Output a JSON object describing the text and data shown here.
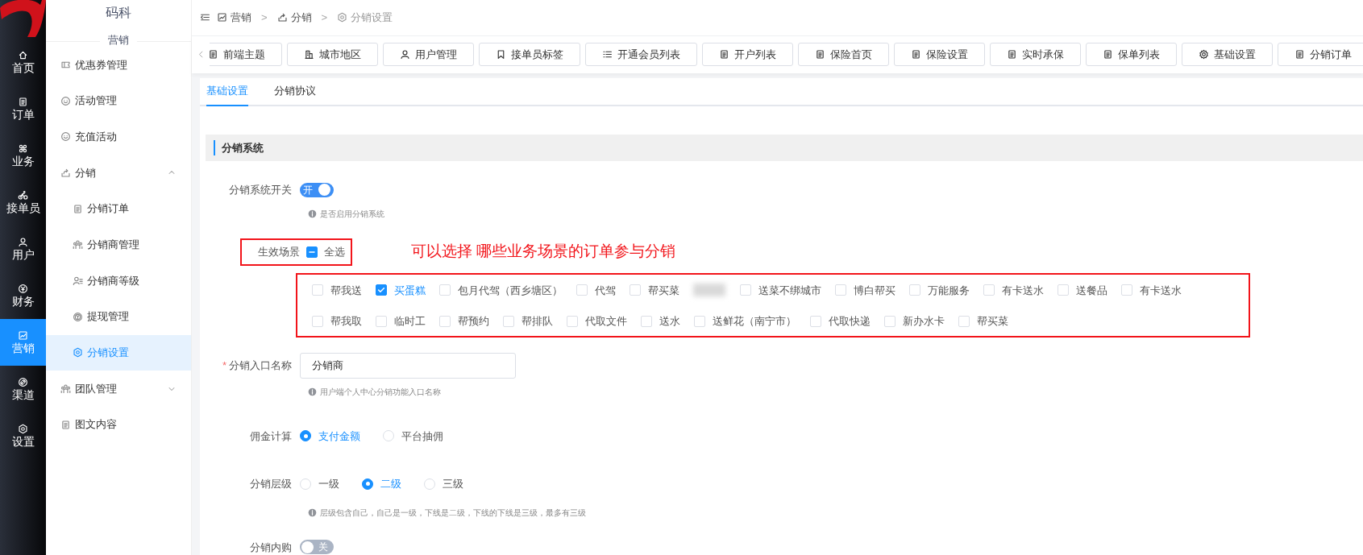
{
  "app_title": "码科",
  "section_title": "营销",
  "rail": [
    {
      "label": "首页",
      "selected": false
    },
    {
      "label": "订单",
      "selected": false
    },
    {
      "label": "业务",
      "selected": false
    },
    {
      "label": "接单员",
      "selected": false
    },
    {
      "label": "用户",
      "selected": false
    },
    {
      "label": "财务",
      "selected": false
    },
    {
      "label": "营销",
      "selected": true
    },
    {
      "label": "渠道",
      "selected": false
    },
    {
      "label": "设置",
      "selected": false
    }
  ],
  "sidebar": [
    {
      "label": "优惠券管理",
      "selected": false
    },
    {
      "label": "活动管理",
      "selected": false
    },
    {
      "label": "充值活动",
      "selected": false
    },
    {
      "label": "分销",
      "selected": false,
      "expanded": true,
      "children": [
        {
          "label": "分销订单",
          "selected": false
        },
        {
          "label": "分销商管理",
          "selected": false
        },
        {
          "label": "分销商等级",
          "selected": false
        },
        {
          "label": "提现管理",
          "selected": false
        },
        {
          "label": "分销设置",
          "selected": true
        }
      ]
    },
    {
      "label": "团队管理",
      "selected": false,
      "expanded": false
    },
    {
      "label": "图文内容",
      "selected": false
    }
  ],
  "breadcrumb": [
    "营销",
    "分销",
    "分销设置"
  ],
  "breadcrumb_separator": ">",
  "page_tabs": [
    {
      "label": "前端主题",
      "selected": false
    },
    {
      "label": "城市地区",
      "selected": false
    },
    {
      "label": "用户管理",
      "selected": false
    },
    {
      "label": "接单员标签",
      "selected": false
    },
    {
      "label": "开通会员列表",
      "selected": false
    },
    {
      "label": "开户列表",
      "selected": false
    },
    {
      "label": "保险首页",
      "selected": false
    },
    {
      "label": "保险设置",
      "selected": false
    },
    {
      "label": "实时承保",
      "selected": false
    },
    {
      "label": "保单列表",
      "selected": false
    },
    {
      "label": "基础设置",
      "selected": false
    },
    {
      "label": "分销订单",
      "selected": false
    }
  ],
  "content_tabs": [
    {
      "label": "基础设置",
      "selected": true
    },
    {
      "label": "分销协议",
      "selected": false
    }
  ],
  "section": "分销系统",
  "fields": [
    {
      "kind": "switch",
      "label": "分销系统开关",
      "on": true,
      "state_text": "开",
      "hint": "是否启用分销系统"
    },
    {
      "kind": "scenes",
      "label": "生效场景",
      "select_all": {
        "label": "全选",
        "indeterminate": true
      },
      "note": "可以选择 哪些业务场景的订单参与分销",
      "options": [
        {
          "kind": "option",
          "label": "帮我送",
          "checked": false
        },
        {
          "kind": "option",
          "label": "买蛋糕",
          "checked": true
        },
        {
          "kind": "option",
          "label": "包月代驾（西乡塘区）",
          "checked": false
        },
        {
          "kind": "option",
          "label": "代驾",
          "checked": false
        },
        {
          "kind": "option",
          "label": "帮买菜",
          "checked": false
        },
        {
          "kind": "blurred"
        },
        {
          "kind": "option",
          "label": "送菜不绑城市",
          "checked": false
        },
        {
          "kind": "option",
          "label": "博白帮买",
          "checked": false
        },
        {
          "kind": "option",
          "label": "万能服务",
          "checked": false
        },
        {
          "kind": "option",
          "label": "有卡送水",
          "checked": false
        },
        {
          "kind": "option",
          "label": "送餐品",
          "checked": false
        },
        {
          "kind": "option",
          "label": "有卡送水",
          "checked": false
        },
        {
          "kind": "option",
          "label": "帮我取",
          "checked": false
        },
        {
          "kind": "option",
          "label": "临时工",
          "checked": false
        },
        {
          "kind": "option",
          "label": "帮预约",
          "checked": false
        },
        {
          "kind": "option",
          "label": "帮排队",
          "checked": false
        },
        {
          "kind": "option",
          "label": "代取文件",
          "checked": false
        },
        {
          "kind": "option",
          "label": "送水",
          "checked": false
        },
        {
          "kind": "option",
          "label": "送鲜花（南宁市）",
          "checked": false
        },
        {
          "kind": "option",
          "label": "代取快递",
          "checked": false
        },
        {
          "kind": "option",
          "label": "新办水卡",
          "checked": false
        },
        {
          "kind": "option",
          "label": "帮买菜",
          "checked": false
        }
      ]
    },
    {
      "kind": "input",
      "label": "分销入口名称",
      "required_mark": "*",
      "value": "分销商",
      "hint": "用户端个人中心分销功能入口名称"
    },
    {
      "kind": "radio",
      "label": "佣金计算",
      "options": [
        {
          "label": "支付金额",
          "selected": true
        },
        {
          "label": "平台抽佣",
          "selected": false
        }
      ]
    },
    {
      "kind": "radio",
      "label": "分销层级",
      "options": [
        {
          "label": "一级",
          "selected": false
        },
        {
          "label": "二级",
          "selected": true
        },
        {
          "label": "三级",
          "selected": false
        }
      ],
      "hint": "层级包含自己，自己是一级，下线是二级，下线的下线是三级，最多有三级"
    },
    {
      "kind": "switch",
      "label": "分销内购",
      "on": false,
      "state_text": "关"
    }
  ]
}
